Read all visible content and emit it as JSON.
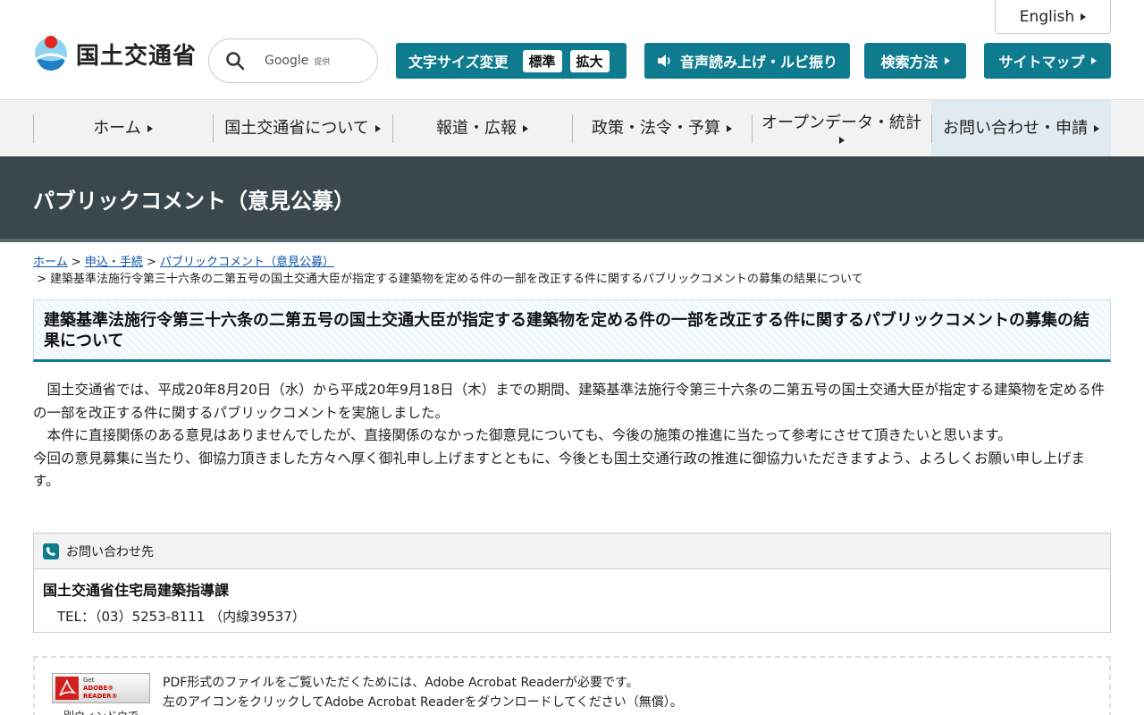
{
  "header": {
    "english_label": "English",
    "logo_text": "国土交通省",
    "search": {
      "brand": "Google",
      "brand_suffix": "提供"
    },
    "text_size": {
      "label": "文字サイズ変更",
      "standard": "標準",
      "large": "拡大"
    },
    "audio_label": "音声読み上げ・ルビ振り",
    "howto_label": "検索方法",
    "sitemap_label": "サイトマップ"
  },
  "nav": {
    "items": [
      {
        "label": "ホーム"
      },
      {
        "label": "国土交通省について"
      },
      {
        "label": "報道・広報"
      },
      {
        "label": "政策・法令・予算"
      },
      {
        "label": "オープンデータ・統計"
      },
      {
        "label": "お問い合わせ・申請"
      }
    ]
  },
  "banner": {
    "title": "パブリックコメント（意見公募）"
  },
  "breadcrumb": {
    "items": [
      "ホーム",
      "申込・手続",
      "パブリックコメント（意見公募）"
    ],
    "current": "建築基準法施行令第三十六条の二第五号の国土交通大臣が指定する建築物を定める件の一部を改正する件に関するパブリックコメントの募集の結果について"
  },
  "page_title": "建築基準法施行令第三十六条の二第五号の国土交通大臣が指定する建築物を定める件の一部を改正する件に関するパブリックコメントの募集の結果について",
  "body": {
    "p1": "国土交通省では、平成20年8月20日（水）から平成20年9月18日（木）までの期間、建築基準法施行令第三十六条の二第五号の国土交通大臣が指定する建築物を定める件の一部を改正する件に関するパブリックコメントを実施しました。",
    "p2": "本件に直接関係のある意見はありませんでしたが、直接関係のなかった御意見についても、今後の施策の推進に当たって参考にさせて頂きたいと思います。",
    "p3": "今回の意見募集に当たり、御協力頂きました方々へ厚く御礼申し上げますとともに、今後とも国土交通行政の推進に御協力いただきますよう、よろしくお願い申し上げます。"
  },
  "contact": {
    "heading": "お問い合わせ先",
    "org": "国土交通省住宅局建築指導課",
    "tel": "TEL：（03）5253-8111 （内線39537）"
  },
  "pdf": {
    "get": "Get",
    "adobe": "ADOBE® READER®",
    "new_window": "別ウィンドウで",
    "line1": "PDF形式のファイルをご覧いただくためには、Adobe Acrobat Readerが必要です。",
    "line2": "左のアイコンをクリックしてAdobe Acrobat Readerをダウンロードしてください（無償）。"
  },
  "colors": {
    "accent": "#0f7b8f",
    "banner": "#3a474c",
    "link": "#0b55a8"
  }
}
